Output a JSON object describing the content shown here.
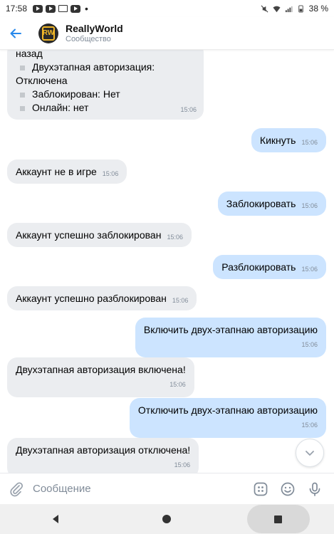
{
  "status_bar": {
    "time": "17:58",
    "battery": "38 %",
    "notification_dot": "•"
  },
  "header": {
    "title": "ReallyWorld",
    "subtitle": "Сообщество",
    "avatar_letters": "RW"
  },
  "info_message": {
    "lines": [
      {
        "text": "назад",
        "bullet": false
      },
      {
        "text": "Двухэтапная авторизация:",
        "bullet": true
      },
      {
        "text": "Отключена",
        "bullet": false
      },
      {
        "text": "Заблокирован: Нет",
        "bullet": true
      },
      {
        "text": "Онлайн: нет",
        "bullet": true
      }
    ],
    "time": "15:06"
  },
  "messages": [
    {
      "dir": "out",
      "text": "Кикнуть",
      "time": "15:06"
    },
    {
      "dir": "in",
      "text": "Аккаунт не в игре",
      "time": "15:06"
    },
    {
      "dir": "out",
      "text": "Заблокировать",
      "time": "15:06"
    },
    {
      "dir": "in",
      "text": "Аккаунт успешно заблокирован",
      "time": "15:06"
    },
    {
      "dir": "out",
      "text": "Разблокировать",
      "time": "15:06"
    },
    {
      "dir": "in",
      "text": "Аккаунт успешно разблокирован",
      "time": "15:06"
    },
    {
      "dir": "out",
      "text": "Включить двух-этапнаю авторизацию",
      "time": "15:06"
    },
    {
      "dir": "in",
      "text": "Двухэтапная авторизация включена!",
      "time": "15:06"
    },
    {
      "dir": "out",
      "text": "Отключить двух-этапнаю авторизацию",
      "time": "15:06"
    },
    {
      "dir": "in",
      "text": "Двухэтапная авторизация отключена!",
      "time": "15:06"
    }
  ],
  "composer": {
    "placeholder": "Сообщение"
  },
  "colors": {
    "accent": "#2688eb",
    "incoming_bubble": "#ebedf0",
    "outgoing_bubble": "#cce4ff",
    "secondary_text": "#818c99"
  },
  "icons": {
    "back": "arrow-left-icon",
    "attach": "paperclip-icon",
    "keyboard": "bot-keyboard-icon",
    "emoji": "smile-icon",
    "voice": "microphone-icon",
    "scroll": "chevron-down-icon"
  }
}
